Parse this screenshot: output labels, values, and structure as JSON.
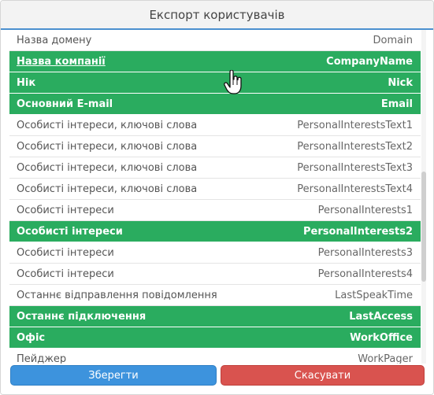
{
  "dialog": {
    "title": "Експорт користувачів"
  },
  "rows": [
    {
      "label": "Назва домену",
      "field": "Domain",
      "selected": false,
      "underlined": false
    },
    {
      "label": "Назва компанії",
      "field": "CompanyName",
      "selected": true,
      "underlined": true
    },
    {
      "label": "Нік",
      "field": "Nick",
      "selected": true,
      "underlined": false
    },
    {
      "label": "Основний E-mail",
      "field": "Email",
      "selected": true,
      "underlined": false
    },
    {
      "label": "Особисті інтереси, ключові слова",
      "field": "PersonalInterestsText1",
      "selected": false,
      "underlined": false
    },
    {
      "label": "Особисті інтереси, ключові слова",
      "field": "PersonalInterestsText2",
      "selected": false,
      "underlined": false
    },
    {
      "label": "Особисті інтереси, ключові слова",
      "field": "PersonalInterestsText3",
      "selected": false,
      "underlined": false
    },
    {
      "label": "Особисті інтереси, ключові слова",
      "field": "PersonalInterestsText4",
      "selected": false,
      "underlined": false
    },
    {
      "label": "Особисті інтереси",
      "field": "PersonalInterests1",
      "selected": false,
      "underlined": false
    },
    {
      "label": "Особисті інтереси",
      "field": "PersonalInterests2",
      "selected": true,
      "underlined": false
    },
    {
      "label": "Особисті інтереси",
      "field": "PersonalInterests3",
      "selected": false,
      "underlined": false
    },
    {
      "label": "Особисті інтереси",
      "field": "PersonalInterests4",
      "selected": false,
      "underlined": false
    },
    {
      "label": "Останнє відправлення повідомлення",
      "field": "LastSpeakTime",
      "selected": false,
      "underlined": false
    },
    {
      "label": "Останнє підключення",
      "field": "LastAccess",
      "selected": true,
      "underlined": false
    },
    {
      "label": "Офіс",
      "field": "WorkOffice",
      "selected": true,
      "underlined": false
    },
    {
      "label": "Пейджер",
      "field": "WorkPager",
      "selected": false,
      "underlined": false
    }
  ],
  "footer": {
    "save_label": "Зберегти",
    "cancel_label": "Скасувати"
  },
  "colors": {
    "selected_row": "#2aac5f",
    "header_accent": "#4b90cf",
    "save_button": "#3d93dd",
    "cancel_button": "#d9534f"
  },
  "cursor": {
    "icon": "hand-pointer-icon"
  }
}
